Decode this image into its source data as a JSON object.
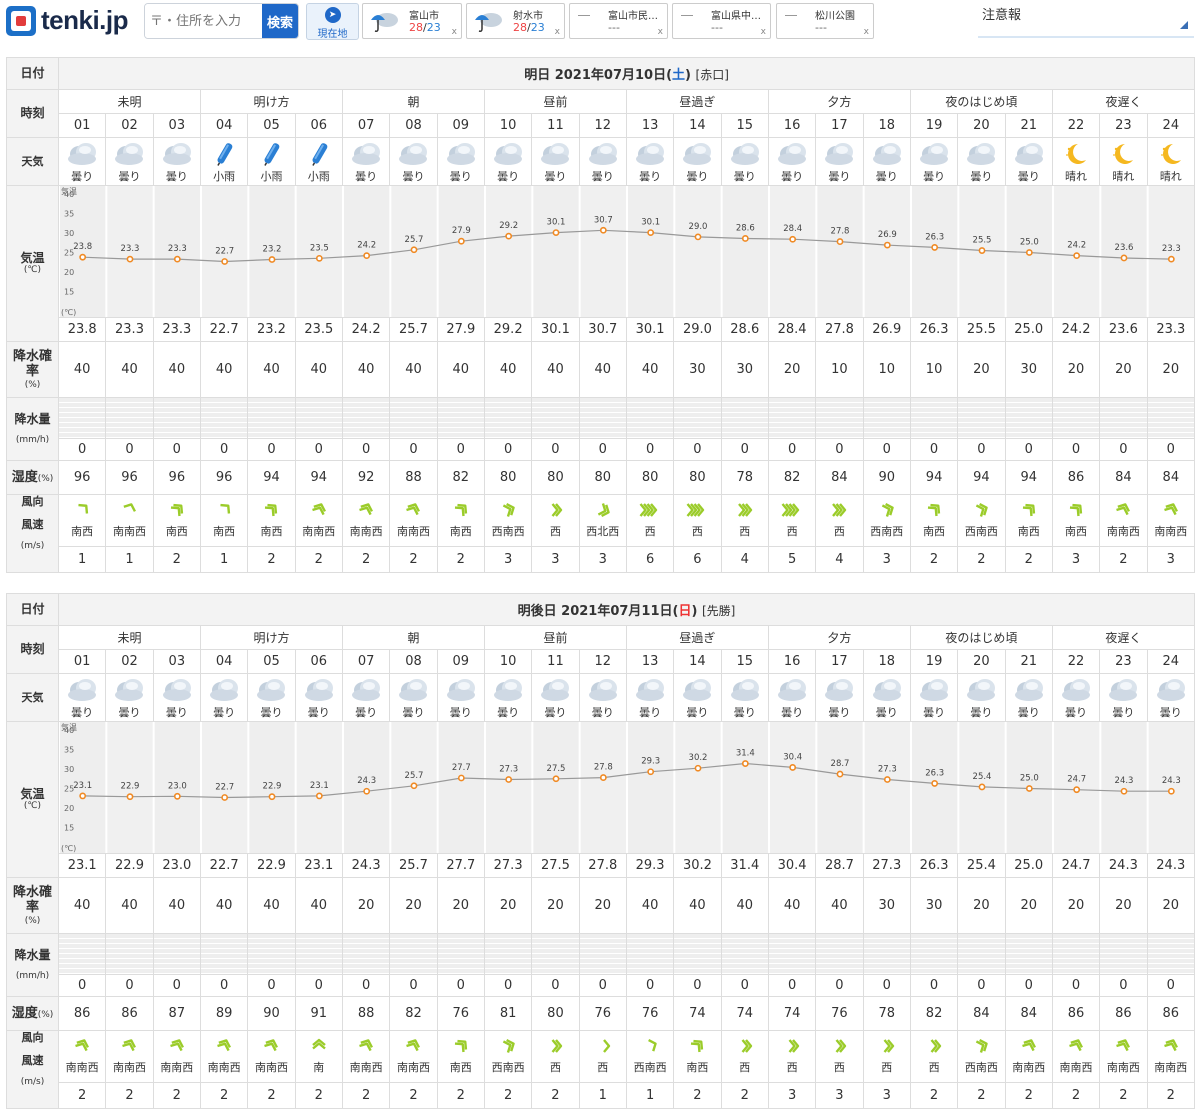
{
  "header": {
    "logo": "tenki.jp",
    "search_placeholder": "〒・住所を入力",
    "search_button": "検索",
    "current_location": "現在地",
    "tabs": [
      {
        "name": "富山市",
        "hi": "28",
        "lo": "23",
        "icon": "rain-umbrella-icon",
        "close": "x"
      },
      {
        "name": "射水市",
        "hi": "28",
        "lo": "23",
        "icon": "rain-umbrella-icon",
        "close": "x"
      },
      {
        "name": "富山市民…",
        "value": "---",
        "close": "x"
      },
      {
        "name": "富山県中…",
        "value": "---",
        "close": "x"
      },
      {
        "name": "松川公園",
        "value": "---",
        "close": "x"
      }
    ],
    "notice": "注意報"
  },
  "labels": {
    "date": "日付",
    "time": "時刻",
    "weather": "天気",
    "temp": "気温",
    "temp_unit": "(℃)",
    "pop": "降水確率",
    "pop_unit": "(%)",
    "precip": "降水量",
    "precip_unit": "(mm/h)",
    "humidity": "湿度",
    "humidity_unit": "(%)",
    "wind_dir": "風向",
    "wind_speed": "風速",
    "wind_unit": "(m/s)",
    "chart_top_label": "気温",
    "chart_bottom_label": "(℃)",
    "yticks": [
      "40",
      "35",
      "30",
      "25",
      "20",
      "15"
    ]
  },
  "periods": [
    "未明",
    "明け方",
    "朝",
    "昼前",
    "昼過ぎ",
    "夕方",
    "夜のはじめ頃",
    "夜遅く"
  ],
  "hours": [
    "01",
    "02",
    "03",
    "04",
    "05",
    "06",
    "07",
    "08",
    "09",
    "10",
    "11",
    "12",
    "13",
    "14",
    "15",
    "16",
    "17",
    "18",
    "19",
    "20",
    "21",
    "22",
    "23",
    "24"
  ],
  "days": [
    {
      "title_prefix": "明日 2021年07月10日(",
      "dow": "土",
      "title_suffix": ")",
      "rokuyo": "[赤口]",
      "weather": [
        "曇り",
        "曇り",
        "曇り",
        "小雨",
        "小雨",
        "小雨",
        "曇り",
        "曇り",
        "曇り",
        "曇り",
        "曇り",
        "曇り",
        "曇り",
        "曇り",
        "曇り",
        "曇り",
        "曇り",
        "曇り",
        "曇り",
        "曇り",
        "曇り",
        "晴れ",
        "晴れ",
        "晴れ"
      ],
      "icons": [
        "cloud-icon",
        "cloud-icon",
        "cloud-icon",
        "umbrella-icon",
        "umbrella-icon",
        "umbrella-icon",
        "cloud-icon",
        "cloud-icon",
        "cloud-icon",
        "cloud-icon",
        "cloud-icon",
        "cloud-icon",
        "cloud-icon",
        "cloud-icon",
        "cloud-icon",
        "cloud-icon",
        "cloud-icon",
        "cloud-icon",
        "cloud-icon",
        "cloud-icon",
        "cloud-icon",
        "moon-icon",
        "moon-icon",
        "moon-icon"
      ],
      "temp": [
        "23.8",
        "23.3",
        "23.3",
        "22.7",
        "23.2",
        "23.5",
        "24.2",
        "25.7",
        "27.9",
        "29.2",
        "30.1",
        "30.7",
        "30.1",
        "29.0",
        "28.6",
        "28.4",
        "27.8",
        "26.9",
        "26.3",
        "25.5",
        "25.0",
        "24.2",
        "23.6",
        "23.3"
      ],
      "pop": [
        "40",
        "40",
        "40",
        "40",
        "40",
        "40",
        "40",
        "40",
        "40",
        "40",
        "40",
        "40",
        "40",
        "30",
        "30",
        "20",
        "10",
        "10",
        "10",
        "20",
        "30",
        "20",
        "20",
        "20"
      ],
      "precip": [
        "0",
        "0",
        "0",
        "0",
        "0",
        "0",
        "0",
        "0",
        "0",
        "0",
        "0",
        "0",
        "0",
        "0",
        "0",
        "0",
        "0",
        "0",
        "0",
        "0",
        "0",
        "0",
        "0",
        "0"
      ],
      "humidity": [
        "96",
        "96",
        "96",
        "96",
        "94",
        "94",
        "92",
        "88",
        "82",
        "80",
        "80",
        "80",
        "80",
        "80",
        "78",
        "82",
        "84",
        "90",
        "94",
        "94",
        "94",
        "86",
        "84",
        "84"
      ],
      "wind_dir": [
        "南西",
        "南南西",
        "南西",
        "南西",
        "南西",
        "南南西",
        "南南西",
        "南南西",
        "南西",
        "西南西",
        "西",
        "西北西",
        "西",
        "西",
        "西",
        "西",
        "西",
        "西南西",
        "南西",
        "西南西",
        "南西",
        "南西",
        "南南西",
        "南南西"
      ],
      "wind_speed": [
        "1",
        "1",
        "2",
        "1",
        "2",
        "2",
        "2",
        "2",
        "2",
        "3",
        "3",
        "3",
        "6",
        "6",
        "4",
        "5",
        "4",
        "3",
        "2",
        "2",
        "2",
        "3",
        "2",
        "3"
      ]
    },
    {
      "title_prefix": "明後日 2021年07月11日(",
      "dow": "日",
      "title_suffix": ")",
      "rokuyo": "[先勝]",
      "weather": [
        "曇り",
        "曇り",
        "曇り",
        "曇り",
        "曇り",
        "曇り",
        "曇り",
        "曇り",
        "曇り",
        "曇り",
        "曇り",
        "曇り",
        "曇り",
        "曇り",
        "曇り",
        "曇り",
        "曇り",
        "曇り",
        "曇り",
        "曇り",
        "曇り",
        "曇り",
        "曇り",
        "曇り"
      ],
      "icons": [
        "cloud-icon",
        "cloud-icon",
        "cloud-icon",
        "cloud-icon",
        "cloud-icon",
        "cloud-icon",
        "cloud-icon",
        "cloud-icon",
        "cloud-icon",
        "cloud-icon",
        "cloud-icon",
        "cloud-icon",
        "cloud-icon",
        "cloud-icon",
        "cloud-icon",
        "cloud-icon",
        "cloud-icon",
        "cloud-icon",
        "cloud-icon",
        "cloud-icon",
        "cloud-icon",
        "cloud-icon",
        "cloud-icon",
        "cloud-icon"
      ],
      "temp": [
        "23.1",
        "22.9",
        "23.0",
        "22.7",
        "22.9",
        "23.1",
        "24.3",
        "25.7",
        "27.7",
        "27.3",
        "27.5",
        "27.8",
        "29.3",
        "30.2",
        "31.4",
        "30.4",
        "28.7",
        "27.3",
        "26.3",
        "25.4",
        "25.0",
        "24.7",
        "24.3",
        "24.3"
      ],
      "pop": [
        "40",
        "40",
        "40",
        "40",
        "40",
        "40",
        "20",
        "20",
        "20",
        "20",
        "20",
        "20",
        "40",
        "40",
        "40",
        "40",
        "40",
        "30",
        "30",
        "20",
        "20",
        "20",
        "20",
        "20"
      ],
      "precip": [
        "0",
        "0",
        "0",
        "0",
        "0",
        "0",
        "0",
        "0",
        "0",
        "0",
        "0",
        "0",
        "0",
        "0",
        "0",
        "0",
        "0",
        "0",
        "0",
        "0",
        "0",
        "0",
        "0",
        "0"
      ],
      "humidity": [
        "86",
        "86",
        "87",
        "89",
        "90",
        "91",
        "88",
        "82",
        "76",
        "81",
        "80",
        "76",
        "76",
        "74",
        "74",
        "74",
        "76",
        "78",
        "82",
        "84",
        "84",
        "86",
        "86",
        "86"
      ],
      "wind_dir": [
        "南南西",
        "南南西",
        "南南西",
        "南南西",
        "南南西",
        "南",
        "南南西",
        "南南西",
        "南西",
        "西南西",
        "西",
        "西",
        "西南西",
        "南西",
        "西",
        "西",
        "西",
        "西",
        "西",
        "西南西",
        "南南西",
        "南南西",
        "南南西",
        "南南西"
      ],
      "wind_speed": [
        "2",
        "2",
        "2",
        "2",
        "2",
        "2",
        "2",
        "2",
        "2",
        "2",
        "2",
        "1",
        "1",
        "2",
        "2",
        "3",
        "3",
        "3",
        "2",
        "2",
        "2",
        "2",
        "2",
        "2"
      ]
    }
  ],
  "colors": {
    "temp_line": "#999999",
    "temp_dot": "#f08a24",
    "wind_arrow": "#9bcc2a",
    "rain": "#2a7fd4",
    "sun": "#f5b820",
    "cloud": "#b8c8d8"
  },
  "chart_data": [
    {
      "type": "line",
      "x": [
        "01",
        "02",
        "03",
        "04",
        "05",
        "06",
        "07",
        "08",
        "09",
        "10",
        "11",
        "12",
        "13",
        "14",
        "15",
        "16",
        "17",
        "18",
        "19",
        "20",
        "21",
        "22",
        "23",
        "24"
      ],
      "series": [
        {
          "values": [
            23.8,
            23.3,
            23.3,
            22.7,
            23.2,
            23.5,
            24.2,
            25.7,
            27.9,
            29.2,
            30.1,
            30.7,
            30.1,
            29.0,
            28.6,
            28.4,
            27.8,
            26.9,
            26.3,
            25.5,
            25.0,
            24.2,
            23.6,
            23.3
          ]
        }
      ],
      "ylim": [
        10,
        40
      ],
      "ylabel": "気温"
    },
    {
      "type": "line",
      "x": [
        "01",
        "02",
        "03",
        "04",
        "05",
        "06",
        "07",
        "08",
        "09",
        "10",
        "11",
        "12",
        "13",
        "14",
        "15",
        "16",
        "17",
        "18",
        "19",
        "20",
        "21",
        "22",
        "23",
        "24"
      ],
      "series": [
        {
          "values": [
            23.1,
            22.9,
            23.0,
            22.7,
            22.9,
            23.1,
            24.3,
            25.7,
            27.7,
            27.3,
            27.5,
            27.8,
            29.3,
            30.2,
            31.4,
            30.4,
            28.7,
            27.3,
            26.3,
            25.4,
            25.0,
            24.7,
            24.3,
            24.3
          ]
        }
      ],
      "ylim": [
        10,
        40
      ],
      "ylabel": "気温"
    }
  ]
}
